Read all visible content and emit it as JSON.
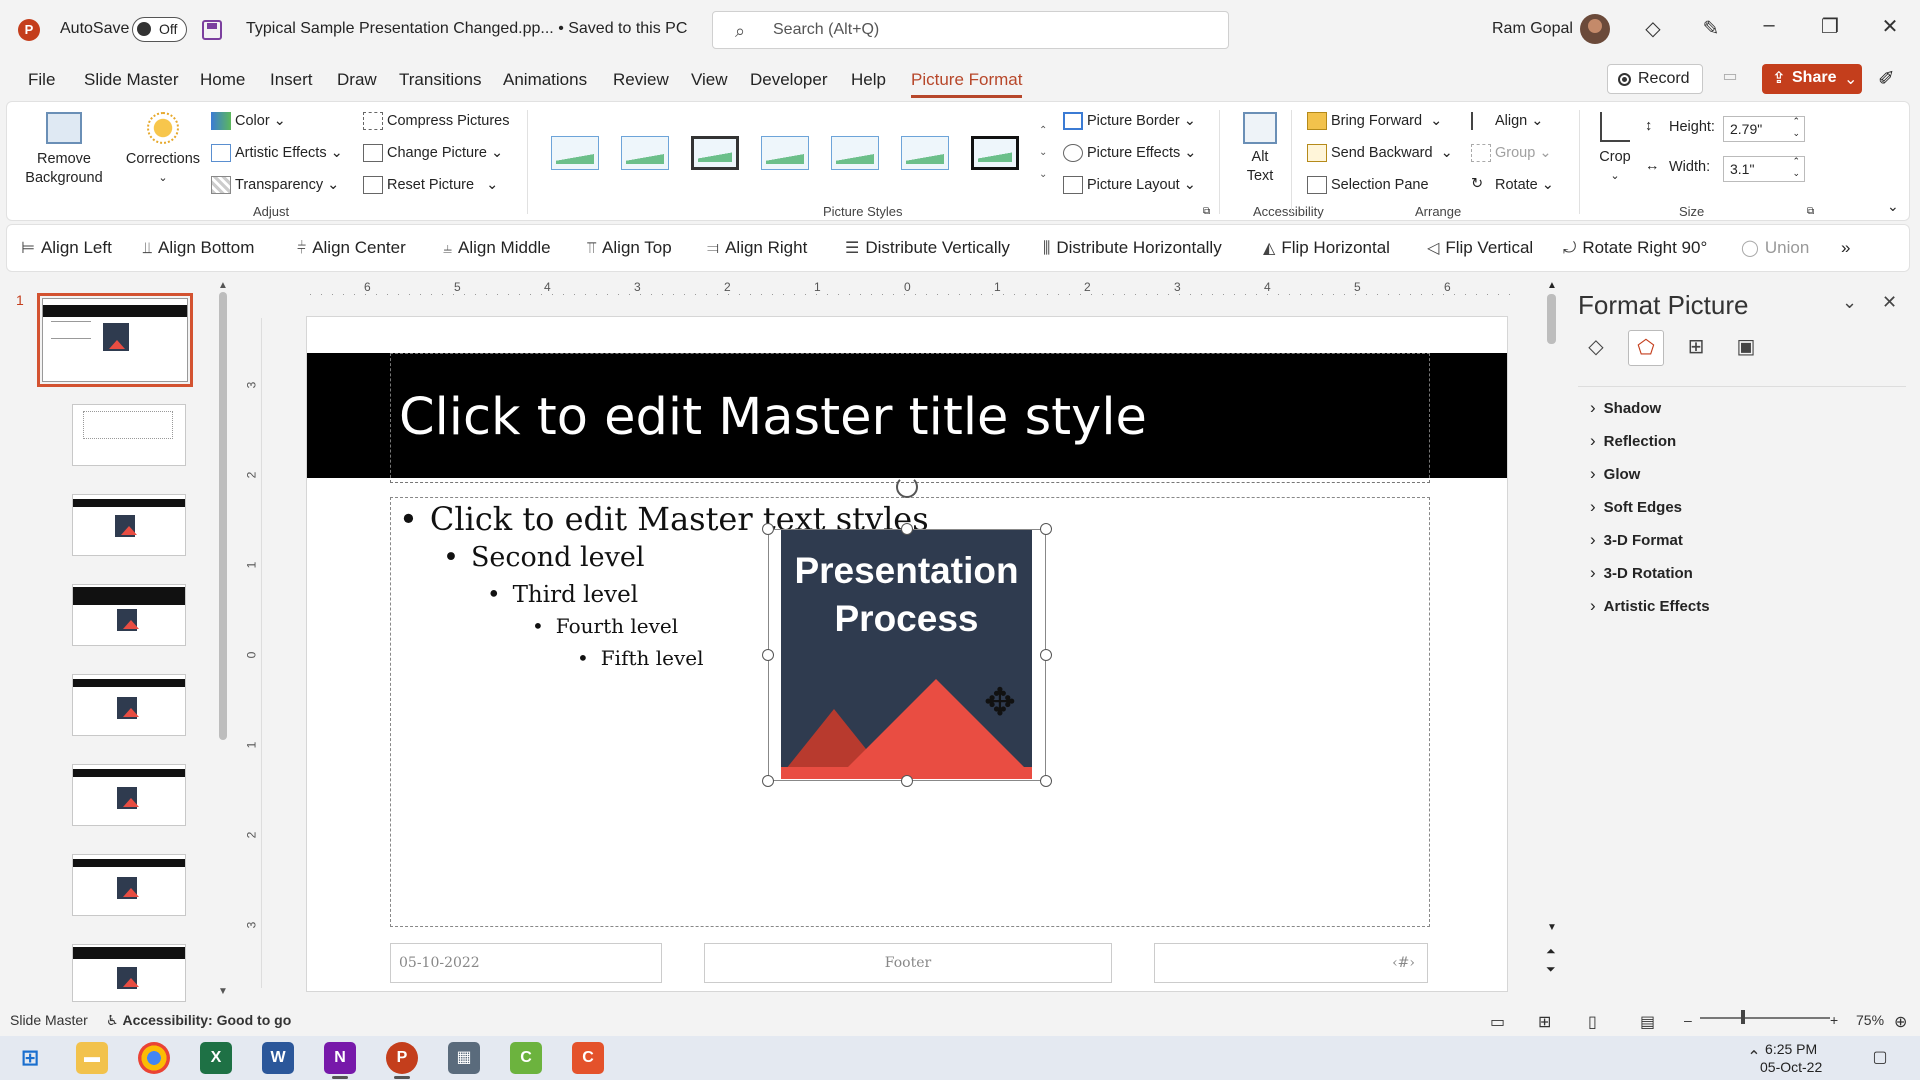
{
  "titlebar": {
    "app_icon": "P",
    "autosave_label": "AutoSave",
    "autosave_state": "Off",
    "doc_title": "Typical Sample Presentation Changed.pp... • Saved to this PC",
    "search_placeholder": "Search (Alt+Q)",
    "user_name": "Ram Gopal"
  },
  "menu": {
    "tabs": [
      "File",
      "Slide Master",
      "Home",
      "Insert",
      "Draw",
      "Transitions",
      "Animations",
      "Review",
      "View",
      "Developer",
      "Help",
      "Picture Format"
    ],
    "active_tab": "Picture Format",
    "record_label": "Record",
    "share_label": "Share"
  },
  "ribbon": {
    "remove_background": "Remove\nBackground",
    "corrections": "Corrections",
    "color": "Color",
    "artistic_effects": "Artistic Effects",
    "transparency": "Transparency",
    "compress_pictures": "Compress Pictures",
    "change_picture": "Change Picture",
    "reset_picture": "Reset Picture",
    "group_adjust": "Adjust",
    "group_picture_styles": "Picture Styles",
    "picture_border": "Picture Border",
    "picture_effects": "Picture Effects",
    "picture_layout": "Picture Layout",
    "alt_text": "Alt\nText",
    "group_accessibility": "Accessibility",
    "bring_forward": "Bring Forward",
    "send_backward": "Send Backward",
    "selection_pane": "Selection Pane",
    "align": "Align",
    "group": "Group",
    "rotate": "Rotate",
    "group_arrange": "Arrange",
    "crop": "Crop",
    "height_label": "Height:",
    "height_value": "2.79\"",
    "width_label": "Width:",
    "width_value": "3.1\"",
    "group_size": "Size"
  },
  "quickbar": {
    "items": [
      "Align Left",
      "Align Bottom",
      "Align Center",
      "Align Middle",
      "Align Top",
      "Align Right",
      "Distribute Vertically",
      "Distribute Horizontally",
      "Flip Horizontal",
      "Flip Vertical",
      "Rotate Right 90°",
      "Union"
    ]
  },
  "thumbnails": {
    "slide_number": "1"
  },
  "ruler": {
    "h_ticks": [
      "6",
      "5",
      "4",
      "3",
      "2",
      "1",
      "0",
      "1",
      "2",
      "3",
      "4",
      "5",
      "6"
    ],
    "v_ticks": [
      "3",
      "2",
      "1",
      "0",
      "1",
      "2",
      "3"
    ]
  },
  "slide": {
    "title": "Click to edit Master title style",
    "levels": [
      "Click to edit Master text styles",
      "Second level",
      "Third level",
      "Fourth level",
      "Fifth level"
    ],
    "footer_date": "05-10-2022",
    "footer_center": "Footer",
    "footer_page": "‹#›",
    "picture_text": "Presentation Process"
  },
  "format_pane": {
    "title": "Format Picture",
    "sections": [
      "Shadow",
      "Reflection",
      "Glow",
      "Soft Edges",
      "3-D Format",
      "3-D Rotation",
      "Artistic Effects"
    ]
  },
  "statusbar": {
    "view_name": "Slide Master",
    "accessibility": "Accessibility: Good to go",
    "zoom": "75%"
  },
  "taskbar": {
    "time": "6:25 PM",
    "date": "05-Oct-22"
  }
}
